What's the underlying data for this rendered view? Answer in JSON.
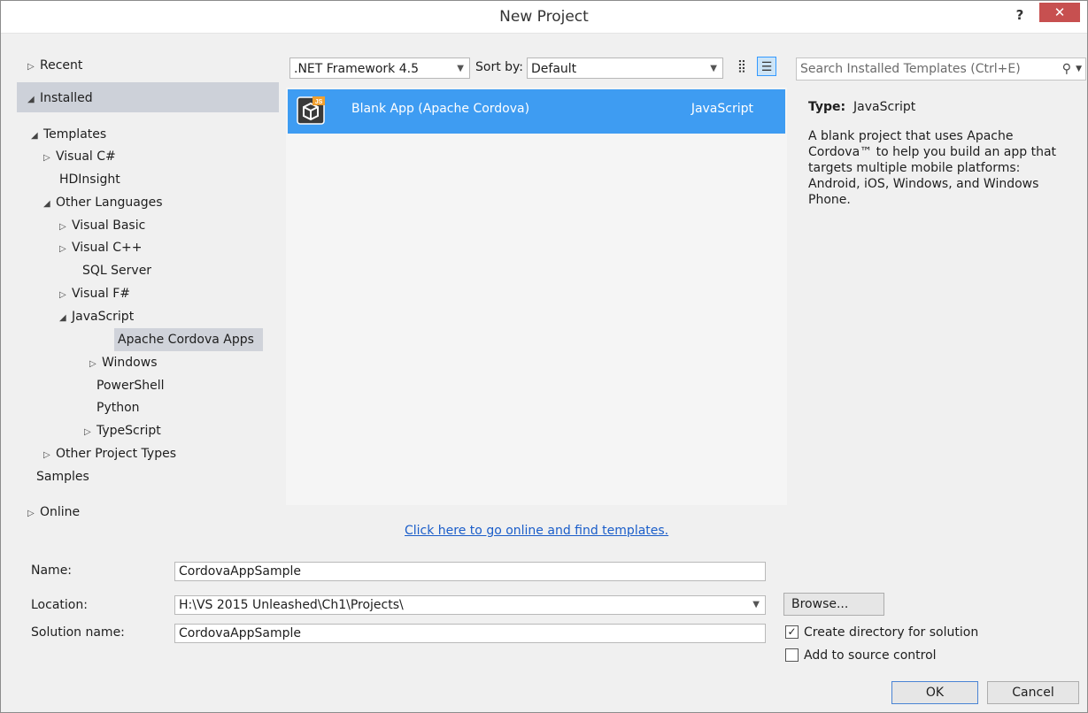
{
  "title": "New Project",
  "title_buttons": {
    "help": "?",
    "close": "✕"
  },
  "tree": {
    "recent": "Recent",
    "installed": "Installed",
    "templates": "Templates",
    "visual_cs": "Visual C#",
    "hdinsight": "HDInsight",
    "other_languages": "Other Languages",
    "visual_basic": "Visual Basic",
    "visual_cpp": "Visual C++",
    "sql_server": "SQL Server",
    "visual_fs": "Visual F#",
    "javascript": "JavaScript",
    "apache_cordova": "Apache Cordova Apps",
    "windows": "Windows",
    "powershell": "PowerShell",
    "python": "Python",
    "typescript": "TypeScript",
    "other_project_types": "Other Project Types",
    "samples": "Samples",
    "online": "Online"
  },
  "toolbar": {
    "framework": ".NET Framework 4.5",
    "sort_label": "Sort by:",
    "sort_value": "Default"
  },
  "search": {
    "placeholder": "Search Installed Templates (Ctrl+E)"
  },
  "templates": [
    {
      "name": "Blank App (Apache Cordova)",
      "language": "JavaScript"
    }
  ],
  "details": {
    "type_label": "Type:",
    "type_value": "JavaScript",
    "description": "A blank project that uses Apache Cordova™ to help you build an app that targets multiple mobile platforms: Android, iOS, Windows, and Windows Phone."
  },
  "online_link": "Click here to go online and find templates.",
  "form": {
    "name_label": "Name:",
    "name_value": "CordovaAppSample",
    "location_label": "Location:",
    "location_value": "H:\\VS 2015 Unleashed\\Ch1\\Projects\\",
    "solution_label": "Solution name:",
    "solution_value": "CordovaAppSample",
    "browse": "Browse...",
    "create_dir": "Create directory for solution",
    "create_dir_checked": true,
    "source_control": "Add to source control",
    "source_control_checked": false,
    "ok": "OK",
    "cancel": "Cancel"
  },
  "colors": {
    "accent": "#3e9cf2",
    "close": "#c75050",
    "link": "#1a5dc9"
  }
}
